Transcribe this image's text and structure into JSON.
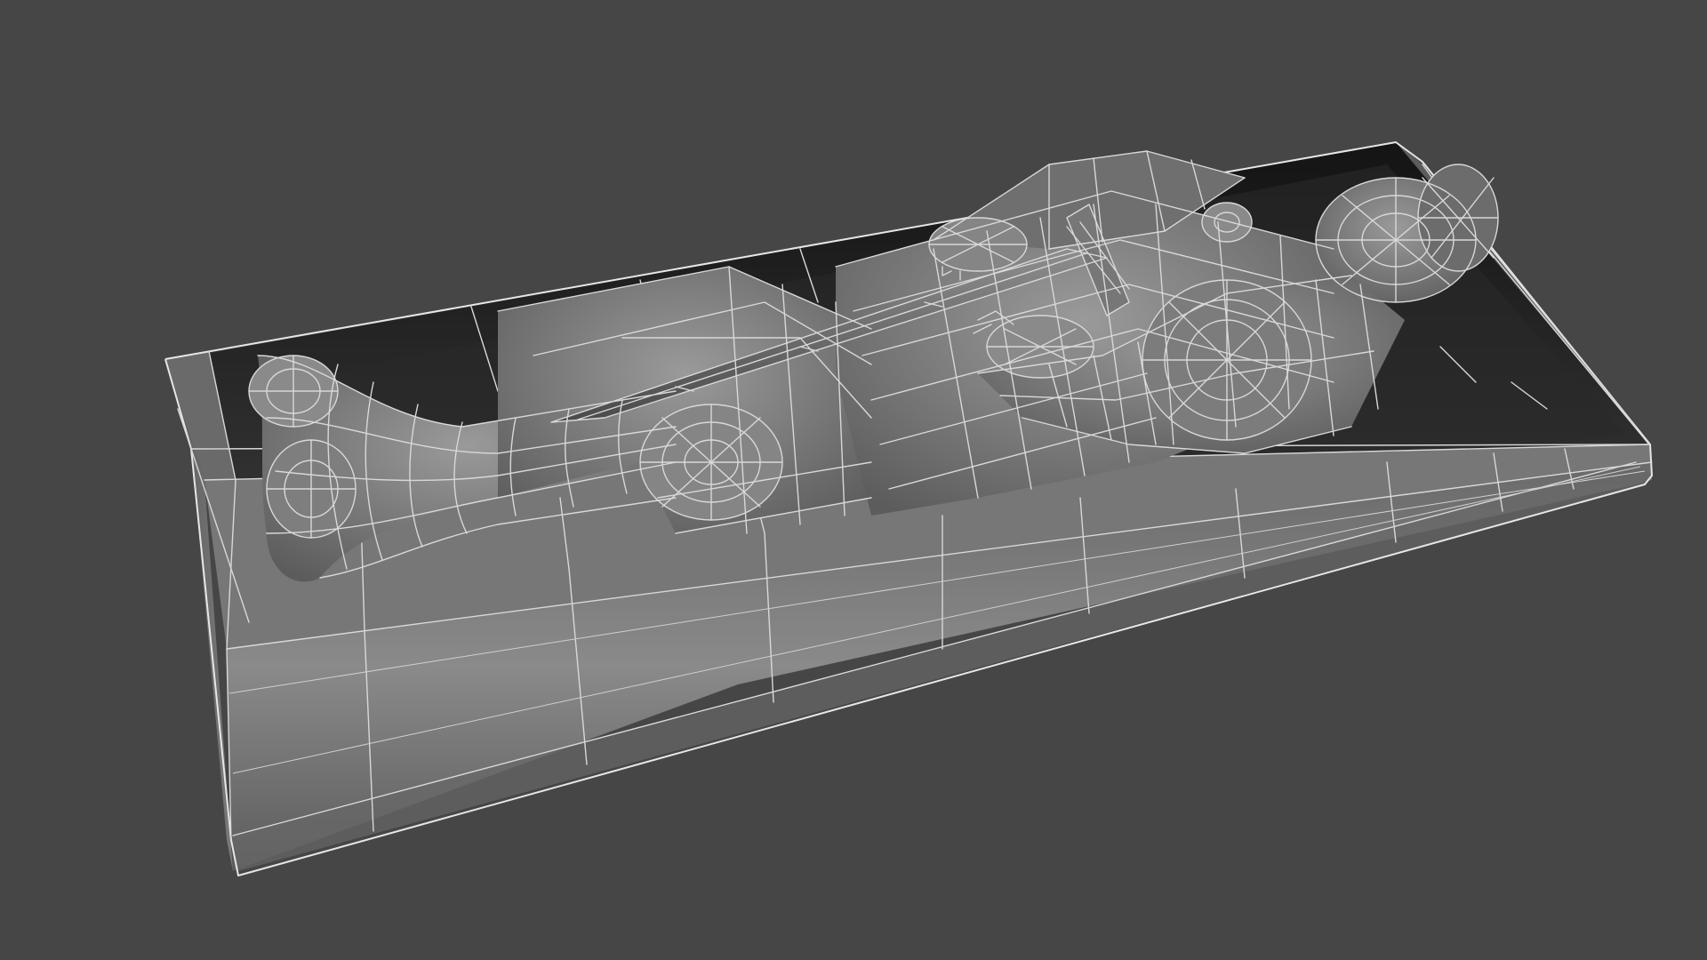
{
  "scene": {
    "background_color": "#464646",
    "subject": "wireframe-tomb-effigy",
    "wire_color": "#d8d8d8",
    "slab_top_color": "#6e6e6e",
    "slab_side_color": "#5a5a5a",
    "recess_color": "#1f1f1f",
    "armor_color": "#7a7a7a"
  }
}
